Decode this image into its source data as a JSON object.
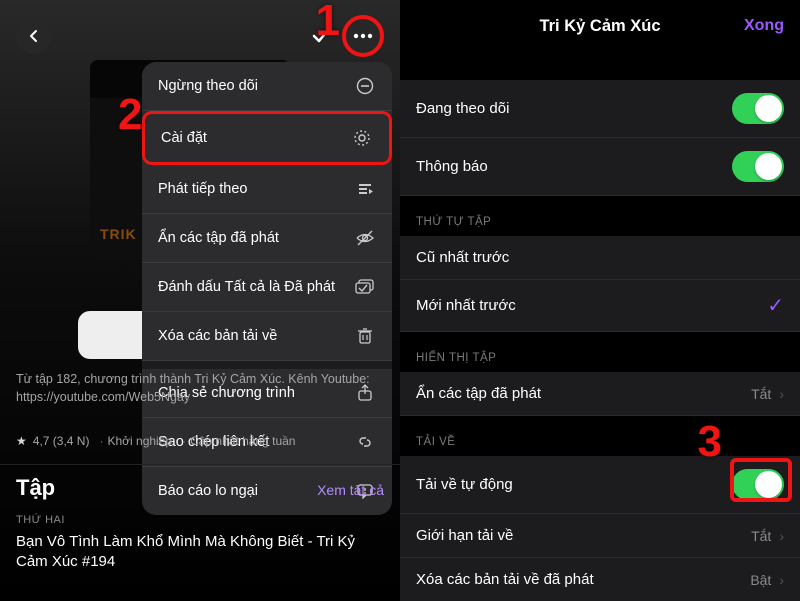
{
  "annotations": {
    "one": "1",
    "two": "2",
    "three": "3"
  },
  "left": {
    "artwork_logo": "TRIK",
    "menu": {
      "unfollow": "Ngừng theo dõi",
      "settings": "Cài đặt",
      "play_next": "Phát tiếp theo",
      "hide_played": "Ẩn các tập đã phát",
      "mark_all_played": "Đánh dấu Tất cả là Đã phát",
      "remove_downloads": "Xóa các bản tải về",
      "share_show": "Chia sẻ chương trình",
      "copy_link": "Sao chép liên kết",
      "report_concern": "Báo cáo lo ngại"
    },
    "description_line1": "Từ tập 182, chương trình",
    "description_line2": "thành Tri Kỷ Cảm Xúc. Kênh Youtube: ",
    "description_link": "https://youtube.com/Web5Ngay",
    "rating_star": "★",
    "rating": "4,7 (3,4 N)",
    "category": "Khởi nghiệp",
    "update_freq": "Cập nhật hằng tuần",
    "section_title": "Tập",
    "see_all": "Xem tất cả",
    "episode_day": "THỨ HAI",
    "episode_title": "Bạn Vô Tình Làm Khổ Mình Mà Không Biết - Tri Kỷ Cảm Xúc #194"
  },
  "right": {
    "title": "Tri Kỷ Cảm Xúc",
    "done": "Xong",
    "following": "Đang theo dõi",
    "notifications": "Thông báo",
    "grp_order": "THỨ TỰ TẬP",
    "order_oldest": "Cũ nhất trước",
    "order_newest": "Mới nhất trước",
    "grp_display": "HIỂN THỊ TẬP",
    "hide_played": "Ẩn các tập đã phát",
    "hide_played_val": "Tắt",
    "grp_download": "TẢI VỀ",
    "auto_download": "Tải về tự động",
    "download_limit": "Giới hạn tải về",
    "download_limit_val": "Tắt",
    "delete_played": "Xóa các bản tải về đã phát",
    "delete_played_val": "Bật"
  }
}
